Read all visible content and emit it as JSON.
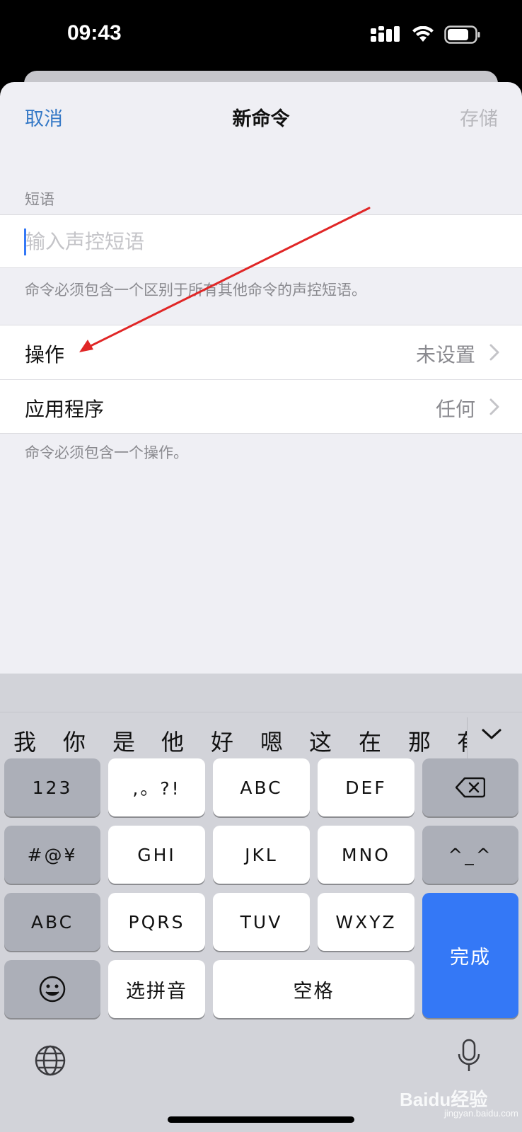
{
  "status_bar": {
    "time": "09:43"
  },
  "nav": {
    "cancel": "取消",
    "title": "新命令",
    "save": "存储"
  },
  "phrase": {
    "section_label": "短语",
    "placeholder": "输入声控短语",
    "value": "",
    "footnote": "命令必须包含一个区别于所有其他命令的声控短语。"
  },
  "rows": [
    {
      "label": "操作",
      "value": "未设置"
    },
    {
      "label": "应用程序",
      "value": "任何"
    }
  ],
  "rows_footnote": "命令必须包含一个操作。",
  "annotation": {
    "color": "#e02626"
  },
  "keyboard": {
    "candidates": [
      "我",
      "你",
      "是",
      "他",
      "好",
      "嗯",
      "这",
      "在",
      "那",
      "有"
    ],
    "keys": {
      "numbers": "123",
      "punct": ",。?!",
      "abc": "ABC",
      "def": "DEF",
      "symbols": "#@¥",
      "ghi": "GHI",
      "jkl": "JKL",
      "mno": "MNO",
      "emoticon": "^_^",
      "latin": "ABC",
      "pqrs": "PQRS",
      "tuv": "TUV",
      "wxyz": "WXYZ",
      "done": "完成",
      "pinyin": "选拼音",
      "space": "空格"
    },
    "icons": [
      "backspace-icon",
      "emoji-icon",
      "globe-icon",
      "microphone-icon",
      "chevron-down-icon"
    ]
  },
  "watermark": {
    "brand": "Baidu经验",
    "url": "jingyan.baidu.com"
  },
  "colors": {
    "accent": "#3478c6",
    "done_key": "#3478f6",
    "arrow": "#e02626"
  }
}
